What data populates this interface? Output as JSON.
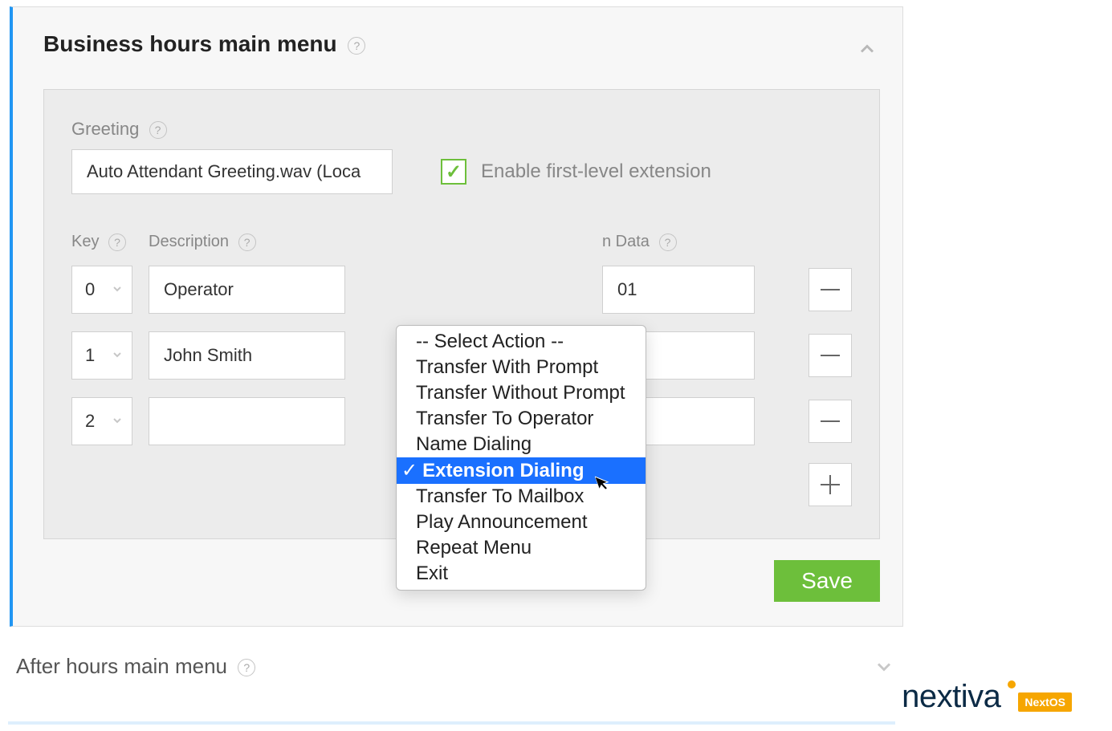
{
  "section": {
    "title": "Business hours main menu"
  },
  "greeting": {
    "label": "Greeting",
    "value": "Auto Attendant Greeting.wav (Loca"
  },
  "enable_ext": {
    "label": "Enable first-level extension",
    "checked": true
  },
  "columns": {
    "key": "Key",
    "desc": "Description",
    "data": "n Data"
  },
  "rows": [
    {
      "key": "0",
      "desc": "Operator",
      "data": "01"
    },
    {
      "key": "1",
      "desc": "John Smith",
      "data": ""
    },
    {
      "key": "2",
      "desc": "",
      "data": ""
    }
  ],
  "dropdown": {
    "options": [
      "-- Select Action --",
      "Transfer With Prompt",
      "Transfer Without Prompt",
      "Transfer To Operator",
      "Name Dialing",
      "Extension Dialing",
      "Transfer To Mailbox",
      "Play Announcement",
      "Repeat Menu",
      "Exit"
    ],
    "selected_index": 5
  },
  "save_label": "Save",
  "after_hours": {
    "title": "After hours main menu"
  },
  "brand": {
    "name": "nextiva",
    "badge": "NextOS"
  }
}
